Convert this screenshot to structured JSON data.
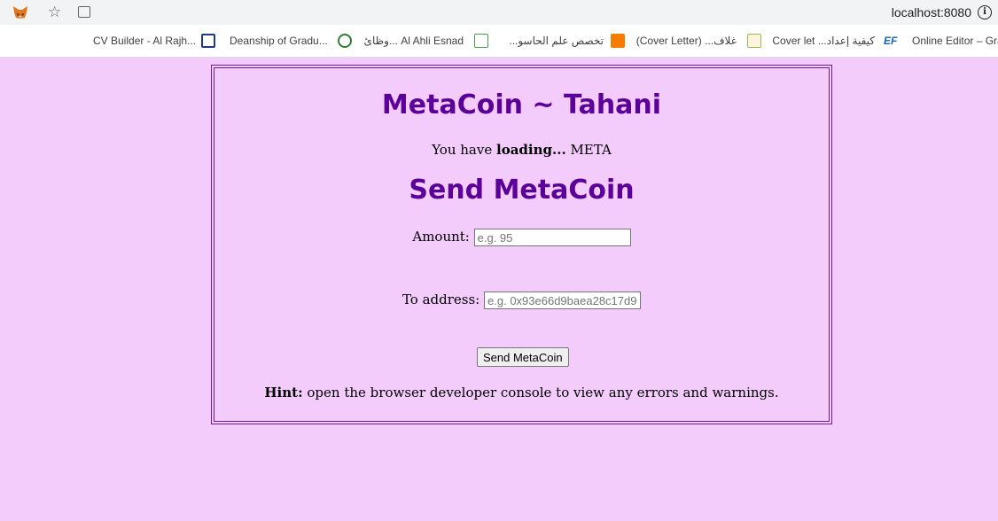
{
  "browser": {
    "url": "localhost:8080",
    "bookmarks": [
      {
        "label": "CV Builder - Al Rajh...",
        "icon": "bank-icon",
        "color": "#1a3a8a"
      },
      {
        "label": "Deanship of Gradu...",
        "icon": "university-seal-icon",
        "color": "#2e7d32"
      },
      {
        "label": "Al Ahli Esnad ...وظائ",
        "icon": "ahli-icon",
        "color": "#43a047"
      },
      {
        "label": "تخصص علم الحاسو...",
        "icon": "blogger-icon",
        "color": "#f57c00"
      },
      {
        "label": "غلاف... (Cover Letter)",
        "icon": "image-icon",
        "color": "#8bc34a"
      },
      {
        "label": "كيفية إعداد... Cover let",
        "icon": "ef-icon",
        "color": "#1565c0"
      },
      {
        "label": "Online Editor – Gra",
        "icon": "",
        "color": ""
      }
    ]
  },
  "app": {
    "title": "MetaCoin ~ Tahani",
    "balance_prefix": "You have",
    "balance_value": "loading...",
    "balance_unit": "META",
    "send_heading": "Send MetaCoin",
    "amount_label": "Amount:",
    "amount_placeholder": "e.g. 95",
    "to_label": "To address:",
    "to_placeholder": "e.g. 0x93e66d9baea28c17d9",
    "send_button": "Send MetaCoin",
    "hint_bold": "Hint:",
    "hint_text": "open the browser developer console to view any errors and warnings."
  },
  "colors": {
    "page_background": "#f3ccfc",
    "heading": "#5c009a",
    "border": "#6a1b9a"
  }
}
